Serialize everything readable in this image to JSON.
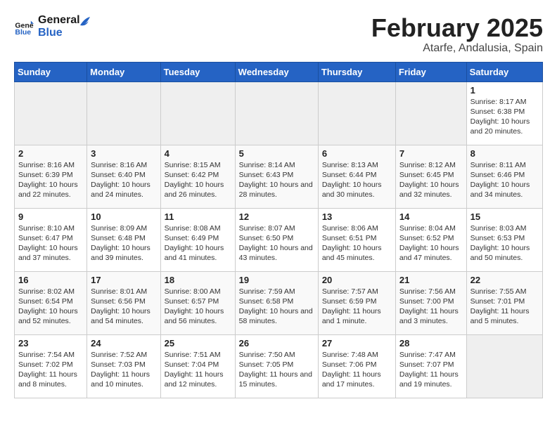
{
  "header": {
    "logo": {
      "line1": "General",
      "line2": "Blue"
    },
    "title": "February 2025",
    "subtitle": "Atarfe, Andalusia, Spain"
  },
  "days_of_week": [
    "Sunday",
    "Monday",
    "Tuesday",
    "Wednesday",
    "Thursday",
    "Friday",
    "Saturday"
  ],
  "weeks": [
    [
      {
        "day": "",
        "info": "",
        "empty": true
      },
      {
        "day": "",
        "info": "",
        "empty": true
      },
      {
        "day": "",
        "info": "",
        "empty": true
      },
      {
        "day": "",
        "info": "",
        "empty": true
      },
      {
        "day": "",
        "info": "",
        "empty": true
      },
      {
        "day": "",
        "info": "",
        "empty": true
      },
      {
        "day": "1",
        "info": "Sunrise: 8:17 AM\nSunset: 6:38 PM\nDaylight: 10 hours and 20 minutes."
      }
    ],
    [
      {
        "day": "2",
        "info": "Sunrise: 8:16 AM\nSunset: 6:39 PM\nDaylight: 10 hours and 22 minutes."
      },
      {
        "day": "3",
        "info": "Sunrise: 8:16 AM\nSunset: 6:40 PM\nDaylight: 10 hours and 24 minutes."
      },
      {
        "day": "4",
        "info": "Sunrise: 8:15 AM\nSunset: 6:42 PM\nDaylight: 10 hours and 26 minutes."
      },
      {
        "day": "5",
        "info": "Sunrise: 8:14 AM\nSunset: 6:43 PM\nDaylight: 10 hours and 28 minutes."
      },
      {
        "day": "6",
        "info": "Sunrise: 8:13 AM\nSunset: 6:44 PM\nDaylight: 10 hours and 30 minutes."
      },
      {
        "day": "7",
        "info": "Sunrise: 8:12 AM\nSunset: 6:45 PM\nDaylight: 10 hours and 32 minutes."
      },
      {
        "day": "8",
        "info": "Sunrise: 8:11 AM\nSunset: 6:46 PM\nDaylight: 10 hours and 34 minutes."
      }
    ],
    [
      {
        "day": "9",
        "info": "Sunrise: 8:10 AM\nSunset: 6:47 PM\nDaylight: 10 hours and 37 minutes."
      },
      {
        "day": "10",
        "info": "Sunrise: 8:09 AM\nSunset: 6:48 PM\nDaylight: 10 hours and 39 minutes."
      },
      {
        "day": "11",
        "info": "Sunrise: 8:08 AM\nSunset: 6:49 PM\nDaylight: 10 hours and 41 minutes."
      },
      {
        "day": "12",
        "info": "Sunrise: 8:07 AM\nSunset: 6:50 PM\nDaylight: 10 hours and 43 minutes."
      },
      {
        "day": "13",
        "info": "Sunrise: 8:06 AM\nSunset: 6:51 PM\nDaylight: 10 hours and 45 minutes."
      },
      {
        "day": "14",
        "info": "Sunrise: 8:04 AM\nSunset: 6:52 PM\nDaylight: 10 hours and 47 minutes."
      },
      {
        "day": "15",
        "info": "Sunrise: 8:03 AM\nSunset: 6:53 PM\nDaylight: 10 hours and 50 minutes."
      }
    ],
    [
      {
        "day": "16",
        "info": "Sunrise: 8:02 AM\nSunset: 6:54 PM\nDaylight: 10 hours and 52 minutes."
      },
      {
        "day": "17",
        "info": "Sunrise: 8:01 AM\nSunset: 6:56 PM\nDaylight: 10 hours and 54 minutes."
      },
      {
        "day": "18",
        "info": "Sunrise: 8:00 AM\nSunset: 6:57 PM\nDaylight: 10 hours and 56 minutes."
      },
      {
        "day": "19",
        "info": "Sunrise: 7:59 AM\nSunset: 6:58 PM\nDaylight: 10 hours and 58 minutes."
      },
      {
        "day": "20",
        "info": "Sunrise: 7:57 AM\nSunset: 6:59 PM\nDaylight: 11 hours and 1 minute."
      },
      {
        "day": "21",
        "info": "Sunrise: 7:56 AM\nSunset: 7:00 PM\nDaylight: 11 hours and 3 minutes."
      },
      {
        "day": "22",
        "info": "Sunrise: 7:55 AM\nSunset: 7:01 PM\nDaylight: 11 hours and 5 minutes."
      }
    ],
    [
      {
        "day": "23",
        "info": "Sunrise: 7:54 AM\nSunset: 7:02 PM\nDaylight: 11 hours and 8 minutes."
      },
      {
        "day": "24",
        "info": "Sunrise: 7:52 AM\nSunset: 7:03 PM\nDaylight: 11 hours and 10 minutes."
      },
      {
        "day": "25",
        "info": "Sunrise: 7:51 AM\nSunset: 7:04 PM\nDaylight: 11 hours and 12 minutes."
      },
      {
        "day": "26",
        "info": "Sunrise: 7:50 AM\nSunset: 7:05 PM\nDaylight: 11 hours and 15 minutes."
      },
      {
        "day": "27",
        "info": "Sunrise: 7:48 AM\nSunset: 7:06 PM\nDaylight: 11 hours and 17 minutes."
      },
      {
        "day": "28",
        "info": "Sunrise: 7:47 AM\nSunset: 7:07 PM\nDaylight: 11 hours and 19 minutes."
      },
      {
        "day": "",
        "info": "",
        "empty": true
      }
    ]
  ]
}
